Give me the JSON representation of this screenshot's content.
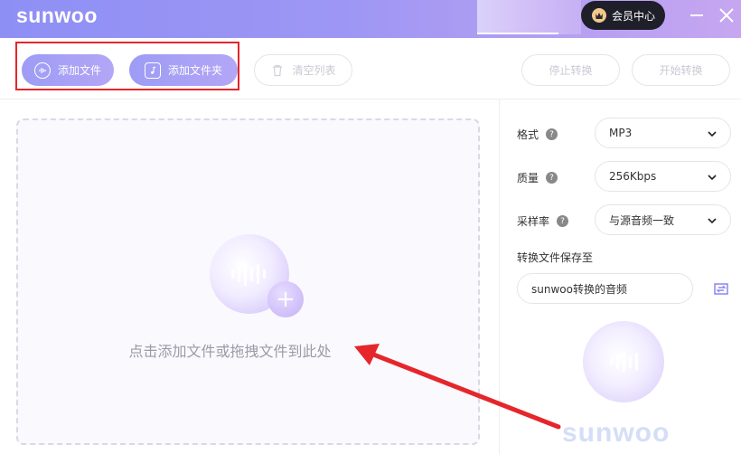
{
  "titlebar": {
    "logo": "sunwoo",
    "vip_label": "会员中心"
  },
  "toolbar": {
    "add_file": "添加文件",
    "add_folder": "添加文件夹",
    "clear_list": "清空列表",
    "stop_convert": "停止转换",
    "start_convert": "开始转换"
  },
  "dropzone": {
    "hint": "点击添加文件或拖拽文件到此处"
  },
  "settings": {
    "format_label": "格式",
    "format_value": "MP3",
    "quality_label": "质量",
    "quality_value": "256Kbps",
    "samplerate_label": "采样率",
    "samplerate_value": "与源音频一致",
    "save_label": "转换文件保存至",
    "save_value": "sunwoo转换的音频"
  },
  "watermark": "sunwoo",
  "colors": {
    "accent": "#9d9cf5",
    "annotation": "#e5262b"
  }
}
